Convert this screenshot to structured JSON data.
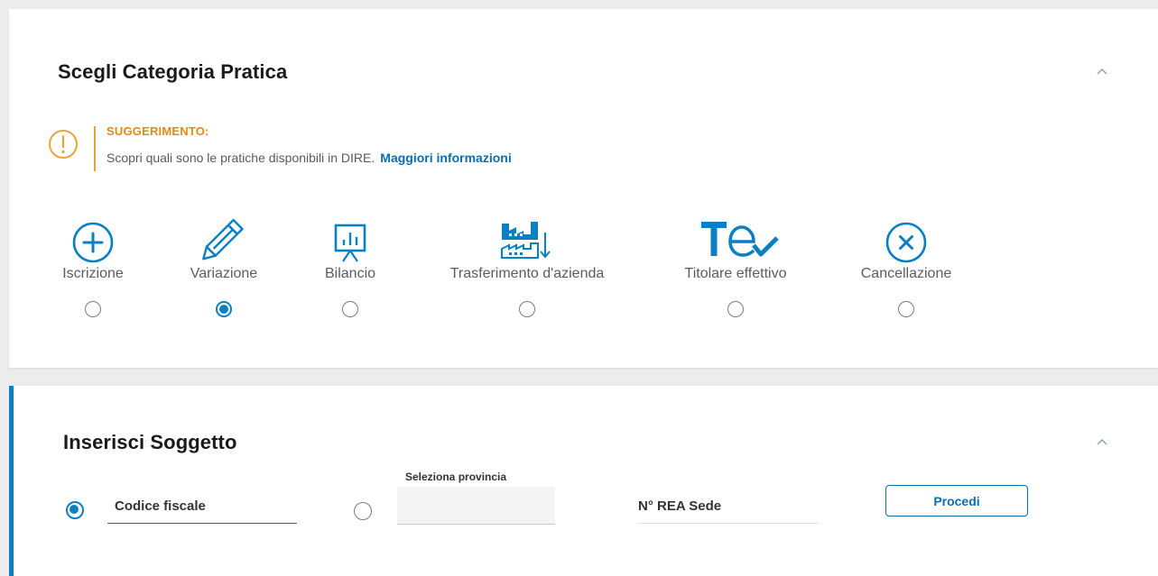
{
  "categoria": {
    "title": "Scegli Categoria Pratica",
    "hint": {
      "title": "SUGGERIMENTO:",
      "text": "Scopri quali sono le pratiche disponibili in DIRE.",
      "link": "Maggiori informazioni"
    },
    "options": [
      {
        "label": "Iscrizione",
        "icon": "plus-circle-icon",
        "checked": false
      },
      {
        "label": "Variazione",
        "icon": "pencil-icon",
        "checked": true
      },
      {
        "label": "Bilancio",
        "icon": "presentation-chart-icon",
        "checked": false
      },
      {
        "label": "Trasferimento d'azienda",
        "icon": "factory-transfer-icon",
        "checked": false
      },
      {
        "label": "Titolare effettivo",
        "icon": "te-check-icon",
        "checked": false
      },
      {
        "label": "Cancellazione",
        "icon": "x-circle-icon",
        "checked": false
      }
    ]
  },
  "soggetto": {
    "title": "Inserisci Soggetto",
    "codice_fiscale_placeholder": "Codice fiscale",
    "provincia_label": "Seleziona provincia",
    "rea_placeholder": "N° REA Sede",
    "procedi_label": "Procedi",
    "codice_fiscale_selected": true
  },
  "colors": {
    "accent": "#0a7fc2",
    "hint": "#e08a10",
    "link": "#0a6fad"
  }
}
